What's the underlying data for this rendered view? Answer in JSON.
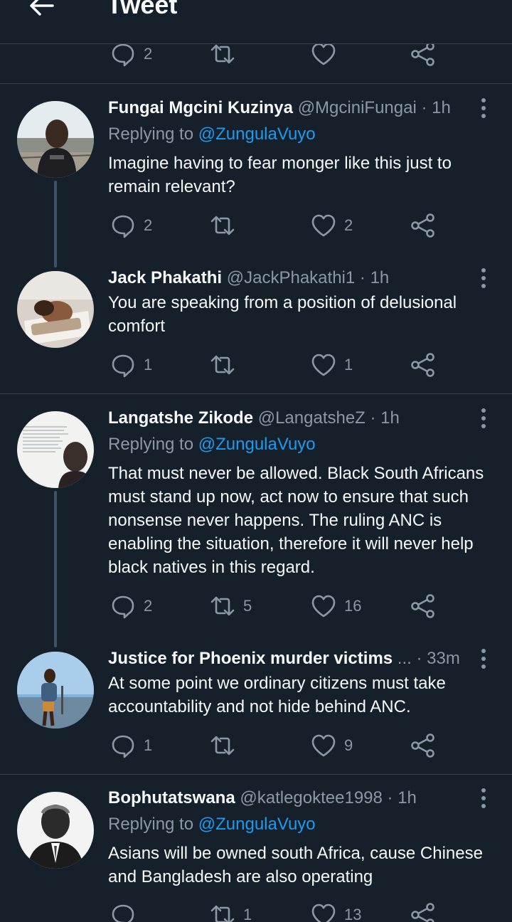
{
  "header": {
    "title": "Tweet",
    "back_icon": "arrow-left-icon"
  },
  "top_actions": {
    "replies": "2",
    "retweets": "",
    "likes": ""
  },
  "tweets": [
    {
      "name": "Fungai Mgcini Kuzinya",
      "handle": "@MgciniFungai",
      "time": "· 1h",
      "replying_prefix": "Replying to ",
      "replying_to": "@ZungulaVuyo",
      "text": "Imagine having to fear monger like this just to remain relevant?",
      "replies": "2",
      "retweets": "",
      "likes": "2"
    },
    {
      "name": "Jack Phakathi",
      "handle": "@JackPhakathi1",
      "time": "· 1h",
      "text": "You are speaking from a position of delusional comfort",
      "replies": "1",
      "retweets": "",
      "likes": "1"
    },
    {
      "name": "Langatshe Zikode",
      "handle": "@LangatsheZ",
      "time": "· 1h",
      "replying_prefix": "Replying to ",
      "replying_to": "@ZungulaVuyo",
      "text": "That must never be allowed. Black South Africans must stand up now, act now to ensure that such nonsense never happens. The ruling ANC is enabling the situation, therefore it will never help black natives in this regard.",
      "replies": "2",
      "retweets": "5",
      "likes": "16"
    },
    {
      "name": "Justice for Phoenix murder victims",
      "handle": "...",
      "time": "· 33m",
      "text": "At some point we ordinary citizens must take accountability and not hide behind ANC.",
      "replies": "1",
      "retweets": "",
      "likes": "9"
    },
    {
      "name": "Bophutatswana",
      "handle": "@katlegoktee1998",
      "time": "· 1h",
      "replying_prefix": "Replying to ",
      "replying_to": "@ZungulaVuyo",
      "text": "Asians will be owned south Africa, cause Chinese and Bangladesh are also operating",
      "replies": "",
      "retweets": "1",
      "likes": "13"
    }
  ],
  "colors": {
    "background": "#15202b",
    "text": "#f7f9f9",
    "muted": "#8b98a5",
    "accent": "#1d9bf0",
    "divider": "#38444d"
  }
}
